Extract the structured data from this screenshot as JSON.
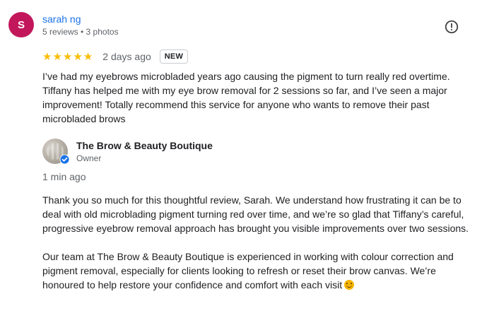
{
  "review": {
    "avatar_initial": "S",
    "reviewer_name": "sarah ng",
    "reviewer_meta": "5 reviews • 3 photos",
    "rating": 5,
    "time": "2 days ago",
    "badge": "NEW",
    "text": "I’ve had my eyebrows microbladed years ago causing the pigment to turn really red overtime. Tiffany has helped me with my eye brow removal for 2 sessions so far, and I’ve seen a major improvement! Totally recommend this service for anyone who wants to remove their past microbladed brows",
    "report_icon": "report-icon"
  },
  "reply": {
    "owner_name": "The Brow & Beauty Boutique",
    "owner_role": "Owner",
    "time": "1 min ago",
    "paragraph_1": "Thank you so much for this thoughtful review, Sarah. We understand how frustrating it can be to deal with old microblading pigment turning red over time, and we’re so glad that Tiffany’s careful, progressive eyebrow removal approach has brought you visible improvements over two sessions.",
    "paragraph_2": "Our team at The Brow & Beauty Boutique is experienced in working with colour correction and pigment removal, especially for clients looking to refresh or reset their brow canvas. We’re honoured to help restore your confidence and comfort with each visit",
    "emoji_icon": "smiling-face-icon"
  },
  "colors": {
    "avatar_bg": "#c2185b",
    "name_link": "#1a73e8",
    "star": "#fbbc04",
    "muted_text": "#5f6368",
    "verified": "#1a73e8"
  }
}
